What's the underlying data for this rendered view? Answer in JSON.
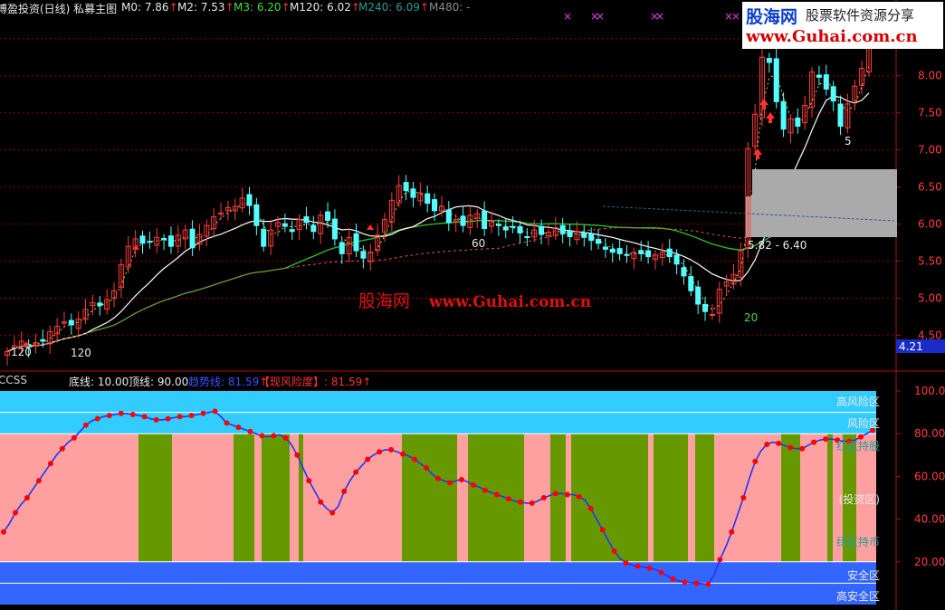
{
  "main_header": {
    "title": "博盈投资(日线) 私募主图",
    "m0": "M0: 7.86",
    "m2": "M2: 7.53",
    "m3": "M3: 6.20",
    "m120": "M120: 6.02",
    "m240": "M240: 6.09",
    "m480": "M480: -",
    "up_arrow": "↑"
  },
  "sub_header": {
    "name": "CCSS",
    "bottom_line": "底线: 10.00",
    "top_line": "顶线: 90.00",
    "trend_line": "趋势线: 81.59",
    "risk_label": "【现风险度】: 81.59"
  },
  "watermark": {
    "logo": "股海网",
    "slogan": "股票软件资源分享",
    "url": "www.Guhai.com.cn",
    "center_logo": "股海网",
    "center_url": "www.Guhai.com.cn"
  },
  "price_axis": [
    "8.00",
    "7.50",
    "7.00",
    "6.50",
    "6.00",
    "5.50",
    "5.00",
    "4.50"
  ],
  "price_badge": "4.21",
  "indicator_axis": [
    "100.0",
    "80.00",
    "60.00",
    "40.00",
    "20.00"
  ],
  "annotations": {
    "low_120": "120",
    "mid_60": "60",
    "low_20": "20",
    "range_label": "5.82 - 6.40",
    "wave_5": "5"
  },
  "zones": {
    "high_risk": "高风险区",
    "risk": "风险区",
    "red_hold": "红区持股",
    "invest": "(投资区)",
    "green_hold": "绿区持币",
    "safe": "安全区",
    "high_safe": "高安全区"
  },
  "colors": {
    "up": "#ff3c3c",
    "down": "#54ffff",
    "ma_fast": "#ffffff",
    "ma_slow": "#28c828",
    "ma_dash": "#e05050",
    "risk_band": "#33ccff",
    "safe_band": "#3366ff",
    "pink_zone": "#ffa0a0",
    "green_zone": "#669900",
    "ccss_line": "#2233ff",
    "ccss_dot": "#ff0000",
    "grid": "#8b0000"
  },
  "chart_data": [
    {
      "type": "candlestick",
      "title": "博盈投资(日线) 私募主图",
      "ylim": [
        4.2,
        8.9
      ],
      "close": [
        4.28,
        4.36,
        4.42,
        4.34,
        4.4,
        4.42,
        4.55,
        4.62,
        4.68,
        4.64,
        4.72,
        4.85,
        4.94,
        4.9,
        4.98,
        5.1,
        5.45,
        5.7,
        5.8,
        5.74,
        5.76,
        5.82,
        5.79,
        5.7,
        5.85,
        5.92,
        5.68,
        5.86,
        5.98,
        6.1,
        6.15,
        6.22,
        6.24,
        6.35,
        6.25,
        5.98,
        5.7,
        5.92,
        6.02,
        5.97,
        5.9,
        6.06,
        6.02,
        5.9,
        6.12,
        6.05,
        5.8,
        5.6,
        5.82,
        5.64,
        5.54,
        5.62,
        5.85,
        6.06,
        6.32,
        6.52,
        6.45,
        6.36,
        6.42,
        6.28,
        6.18,
        6.24,
        6.02,
        6.06,
        5.98,
        6.12,
        6.14,
        5.94,
        6.04,
        5.98,
        5.92,
        5.96,
        5.88,
        5.82,
        5.92,
        5.86,
        5.89,
        5.95,
        5.87,
        5.83,
        5.9,
        5.82,
        5.78,
        5.74,
        5.66,
        5.62,
        5.6,
        5.58,
        5.62,
        5.6,
        5.56,
        5.58,
        5.62,
        5.56,
        5.46,
        5.3,
        5.1,
        4.92,
        4.82,
        4.78,
        5.12,
        5.22,
        5.32,
        5.64,
        7.02,
        7.48,
        8.25,
        8.18,
        7.65,
        7.28,
        7.42,
        7.32,
        7.6,
        8.05,
        7.98,
        7.82,
        7.66,
        7.32,
        7.62,
        7.86,
        8.1,
        8.45
      ],
      "series": [
        {
          "name": "M0",
          "last": 7.86
        },
        {
          "name": "M2",
          "last": 7.53
        },
        {
          "name": "M3",
          "last": 6.2
        },
        {
          "name": "M120",
          "last": 6.02
        },
        {
          "name": "M240",
          "last": 6.09
        }
      ]
    },
    {
      "type": "line",
      "title": "CCSS",
      "ylim": [
        0,
        100
      ],
      "hlines": [
        10,
        20,
        80,
        90
      ],
      "values": [
        34,
        38,
        43,
        47,
        50,
        54,
        58,
        62,
        66,
        70,
        73,
        76,
        78,
        81,
        84,
        86,
        87,
        88,
        88.5,
        89,
        89.5,
        89.5,
        89,
        88.5,
        88,
        87,
        86.5,
        86.5,
        87,
        87.5,
        88,
        88,
        88.5,
        89,
        89.5,
        90,
        90.5,
        88,
        85,
        84,
        83,
        82,
        81,
        80,
        79,
        78.5,
        79,
        79.5,
        78,
        75,
        70,
        64,
        58,
        53,
        48,
        45,
        43,
        46,
        53,
        58,
        62,
        65,
        68,
        70,
        71.5,
        72.5,
        72.5,
        71.5,
        70.5,
        69.5,
        68,
        66,
        64,
        61,
        59,
        58,
        57,
        58,
        58.5,
        57.5,
        56,
        55,
        53.5,
        52.5,
        51.5,
        50.5,
        49.5,
        48.5,
        48,
        47.5,
        47.5,
        48.5,
        50,
        51,
        52,
        52,
        51.5,
        51.5,
        50.5,
        49,
        45,
        40,
        35,
        30,
        25,
        21.5,
        19.5,
        18.5,
        18,
        17.5,
        17,
        16.5,
        15,
        13.5,
        12,
        11,
        10.5,
        10.2,
        10,
        9.8,
        9.5,
        14,
        21,
        27,
        34,
        42,
        50,
        59,
        67,
        72,
        75,
        76,
        75.5,
        74.5,
        73.5,
        73,
        73,
        74.5,
        76,
        77,
        77.5,
        77.5,
        77,
        76.5,
        76.5,
        77,
        78.5,
        80,
        81.6
      ],
      "zone_states": [
        "P",
        "G",
        "P",
        "G",
        "P",
        "G",
        "P",
        "G",
        "P",
        "G",
        "P",
        "G",
        "P",
        "G",
        "P",
        "G",
        "P",
        "G",
        "P",
        "G",
        "P",
        "G",
        "P",
        "G",
        "P",
        "G",
        "P",
        "G",
        "P"
      ],
      "zone_breaks_x_index": [
        0,
        40,
        52,
        68,
        74,
        76,
        83,
        86,
        103,
        117,
        132,
        137,
        157,
        162,
        168,
        171,
        183,
        188,
        193,
        196,
        199,
        211,
        221,
        224,
        229,
        231,
        231,
        231,
        231
      ]
    }
  ]
}
